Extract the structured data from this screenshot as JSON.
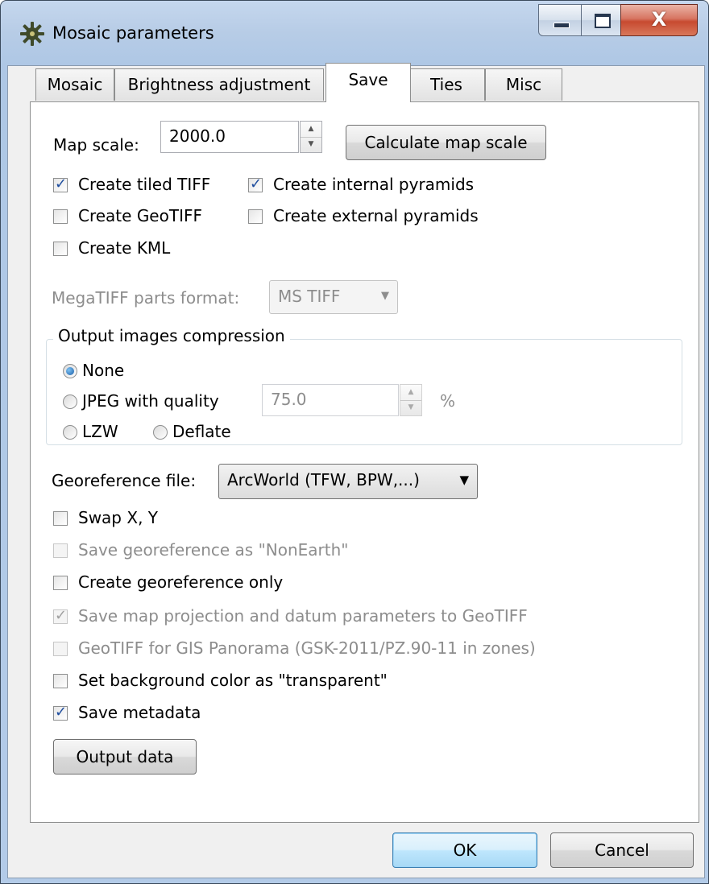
{
  "window": {
    "title": "Mosaic parameters",
    "close_glyph": "X",
    "icon": "app-gear-icon"
  },
  "tabs": [
    {
      "label": "Mosaic",
      "active": false
    },
    {
      "label": "Brightness adjustment",
      "active": false
    },
    {
      "label": "Save",
      "active": true
    },
    {
      "label": "Ties",
      "active": false
    },
    {
      "label": "Misc",
      "active": false
    }
  ],
  "save": {
    "map_scale_label": "Map scale:",
    "map_scale_value": "2000.0",
    "calculate_button": "Calculate map scale",
    "checkboxes_top": [
      {
        "label": "Create tiled TIFF",
        "checked": true
      },
      {
        "label": "Create internal pyramids",
        "checked": true
      },
      {
        "label": "Create GeoTIFF",
        "checked": false
      },
      {
        "label": "Create external pyramids",
        "checked": false
      },
      {
        "label": "Create KML",
        "checked": false
      }
    ],
    "megatiff_label": "MegaTIFF parts format:",
    "megatiff_value": "MS TIFF",
    "compression": {
      "legend": "Output images compression",
      "none": "None",
      "jpeg": "JPEG with quality",
      "jpeg_quality": "75.0",
      "percent": "%",
      "lzw": "LZW",
      "deflate": "Deflate",
      "selected": "None"
    },
    "georeference_label": "Georeference file:",
    "georeference_value": "ArcWorld (TFW, BPW,...)",
    "checkboxes_bottom": [
      {
        "label": "Swap X, Y",
        "checked": false,
        "enabled": true
      },
      {
        "label": "Save georeference as \"NonEarth\"",
        "checked": false,
        "enabled": false
      },
      {
        "label": "Create georeference only",
        "checked": false,
        "enabled": true
      },
      {
        "label": "Save map projection and datum parameters to GeoTIFF",
        "checked": true,
        "enabled": false
      },
      {
        "label": "GeoTIFF for GIS Panorama (GSK-2011/PZ.90-11 in zones)",
        "checked": false,
        "enabled": false
      },
      {
        "label": "Set background color as \"transparent\"",
        "checked": false,
        "enabled": true
      },
      {
        "label": "Save metadata",
        "checked": true,
        "enabled": true
      }
    ],
    "output_data_button": "Output data"
  },
  "footer": {
    "ok": "OK",
    "cancel": "Cancel"
  }
}
